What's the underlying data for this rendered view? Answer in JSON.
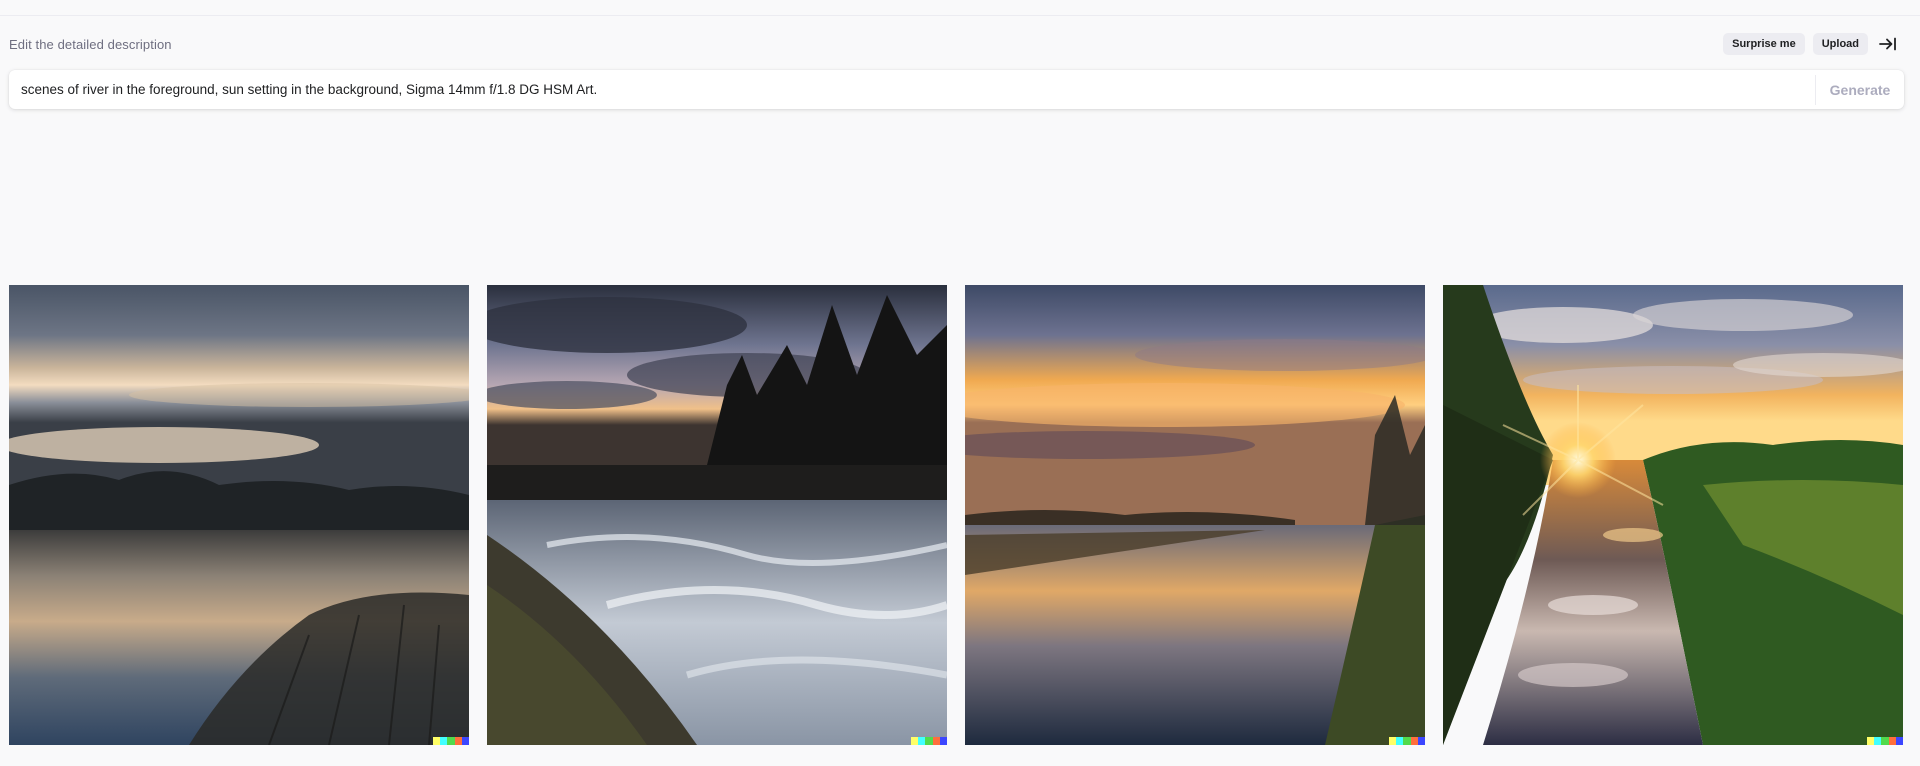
{
  "prompt_panel": {
    "label": "Edit the detailed description",
    "surprise_label": "Surprise me",
    "upload_label": "Upload",
    "prompt_value": "scenes of river in the foreground, sun setting in the background, Sigma 14mm f/1.8 DG HSM Art.",
    "generate_label": "Generate"
  },
  "gallery": {
    "images": [
      {
        "scene": "calm lake at sunset with pale sky and bare bushes"
      },
      {
        "scene": "rushing river rapids at dusk with dark trees"
      },
      {
        "scene": "calm river reflecting orange sunset clouds"
      },
      {
        "scene": "canal with sun bursting between trees, reflected clouds"
      }
    ],
    "signature_colors": [
      "#ffff66",
      "#42ffff",
      "#51da4c",
      "#ff6e3c",
      "#3c46ff"
    ]
  }
}
